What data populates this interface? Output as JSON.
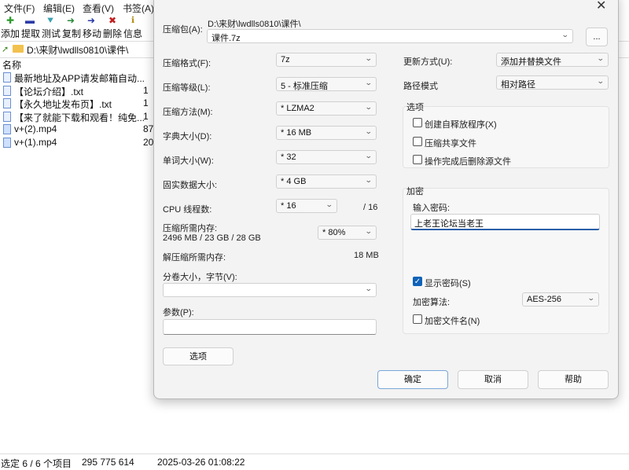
{
  "menu": [
    "文件(F)",
    "编辑(E)",
    "查看(V)",
    "书签(A)"
  ],
  "toolbar": {
    "labels": [
      "添加",
      "提取",
      "测试",
      "复制",
      "移动",
      "删除",
      "信息"
    ],
    "icons": [
      "plus-icon",
      "minus-icon",
      "check-icon",
      "arrow-right-icon",
      "arrow-right-icon",
      "delete-x-icon",
      "info-icon"
    ]
  },
  "address": "D:\\来财\\lwdlls0810\\课件\\",
  "list": {
    "header_name": "名称",
    "files": [
      {
        "name": "最新地址及APP请发邮箱自动...",
        "size": "",
        "type": "txt"
      },
      {
        "name": "【论坛介绍】.txt",
        "size": "1",
        "type": "txt"
      },
      {
        "name": "【永久地址发布页】.txt",
        "size": "1",
        "type": "txt"
      },
      {
        "name": "【来了就能下载和观看！纯免...",
        "size": "1",
        "type": "txt"
      },
      {
        "name": "v+(2).mp4",
        "size": "87",
        "type": "video"
      },
      {
        "name": "v+(1).mp4",
        "size": "20",
        "type": "video"
      }
    ]
  },
  "status": {
    "selected": "选定 6 / 6 个项目",
    "size": "295 775 614",
    "datetime": "2025-03-26 01:08:22"
  },
  "dialog": {
    "close": "✕",
    "archive_label": "压缩包(A):",
    "archive_path": "D:\\来财\\lwdlls0810\\课件\\",
    "archive_name": "课件.7z",
    "browse_label": "...",
    "format_label": "压缩格式(F):",
    "format_value": "7z",
    "level_label": "压缩等级(L):",
    "level_value": "5 - 标准压缩",
    "method_label": "压缩方法(M):",
    "method_value": "*  LZMA2",
    "dict_label": "字典大小(D):",
    "dict_value": "*  16 MB",
    "word_label": "单词大小(W):",
    "word_value": "*  32",
    "solid_label": "固实数据大小:",
    "solid_value": "*  4 GB",
    "cpu_label": "CPU 线程数:",
    "cpu_value": "*  16",
    "cpu_total": "/ 16",
    "mem_comp_label": "压缩所需内存:",
    "mem_comp_value": "2496 MB / 23 GB / 28 GB",
    "mem_percent": "* 80%",
    "mem_decomp_label": "解压缩所需内存:",
    "mem_decomp_value": "18 MB",
    "split_label": "分卷大小，字节(V):",
    "split_value": "",
    "params_label": "参数(P):",
    "params_value": "",
    "options_button": "选项",
    "update_label": "更新方式(U):",
    "update_value": "添加并替换文件",
    "pathmode_label": "路径模式",
    "pathmode_value": "相对路径",
    "options_group": {
      "title": "选项",
      "items": [
        {
          "label": "创建自释放程序(X)",
          "checked": false
        },
        {
          "label": "压缩共享文件",
          "checked": false
        },
        {
          "label": "操作完成后删除源文件",
          "checked": false
        }
      ]
    },
    "encryption": {
      "title": "加密",
      "password_label": "输入密码:",
      "password_value": "上老王论坛当老王",
      "show_password_label": "显示密码(S)",
      "show_password_checked": true,
      "method_label": "加密算法:",
      "method_value": "AES-256",
      "encrypt_names_label": "加密文件名(N)",
      "encrypt_names_checked": false
    },
    "ok_button": "确定",
    "cancel_button": "取消",
    "help_button": "帮助"
  }
}
